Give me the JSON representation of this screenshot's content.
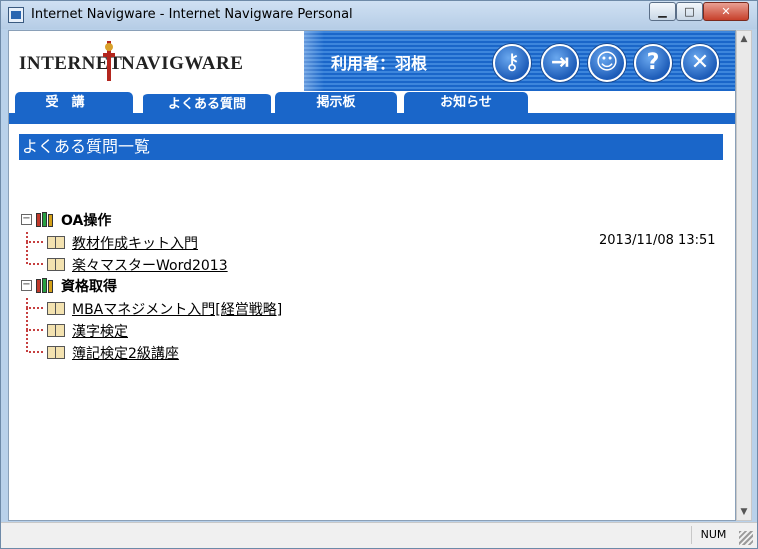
{
  "window": {
    "title": "Internet Navigware - Internet Navigware Personal",
    "minimize_icon": "minimize-icon",
    "maximize_icon": "maximize-icon",
    "close_icon": "close-icon"
  },
  "header": {
    "logo_left": "INTERNET",
    "logo_right": "NAVIGWARE",
    "user_label": "利用者：羽根",
    "buttons": [
      {
        "icon": "key-icon",
        "glyph": "⚷"
      },
      {
        "icon": "exit-door-icon",
        "glyph": "⇥"
      },
      {
        "icon": "smiley-icon",
        "glyph": "☺"
      },
      {
        "icon": "help-icon",
        "glyph": "?"
      },
      {
        "icon": "close-icon",
        "glyph": "✕"
      }
    ],
    "accent_color": "#1a66c9"
  },
  "tabs": [
    {
      "label": "受　講",
      "active": false
    },
    {
      "label": "よくある質問",
      "active": true
    },
    {
      "label": "掲示板",
      "active": false
    },
    {
      "label": "お知らせ",
      "active": false
    }
  ],
  "main": {
    "section_title": "よくある質問一覧",
    "categories": [
      {
        "label": "OA操作",
        "expand_symbol": "−",
        "items": [
          {
            "label": "教材作成キット入門",
            "date": "2013/11/08 13:51"
          },
          {
            "label": "楽々マスターWord2013",
            "date": ""
          }
        ]
      },
      {
        "label": "資格取得",
        "expand_symbol": "−",
        "items": [
          {
            "label": "MBAマネジメント入門[経営戦略]",
            "date": ""
          },
          {
            "label": "漢字検定",
            "date": ""
          },
          {
            "label": "簿記検定2級講座",
            "date": ""
          }
        ]
      }
    ]
  },
  "statusbar": {
    "num": "NUM"
  }
}
